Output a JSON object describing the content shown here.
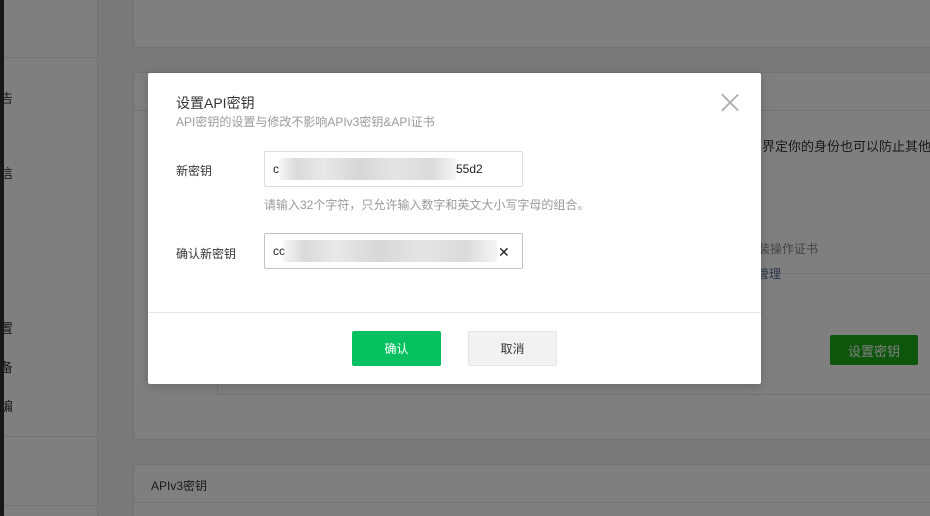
{
  "background": {
    "left_fragments": [
      "告",
      "信",
      "置",
      "备",
      "编"
    ],
    "intro_text": "界定你的身份也可以防止其他人",
    "cert_status": "你已安装操作证书",
    "cert_manage_link": "证书管理",
    "set_key_button": "设置密钥",
    "section_title": "APIv3密钥"
  },
  "dialog": {
    "title": "设置API密钥",
    "subtitle": "API密钥的设置与修改不影响APIv3密钥&API证书",
    "new_key": {
      "label": "新密钥",
      "value_prefix": "c",
      "value_suffix": "55d2"
    },
    "hint": "请输入32个字符，只允许输入数字和英文大小写字母的组合。",
    "confirm_key": {
      "label": "确认新密钥",
      "value_prefix": "cc"
    },
    "confirm_button": "确认",
    "cancel_button": "取消"
  },
  "colors": {
    "primary_green": "#07c160",
    "link_blue": "#576b95",
    "mask": "rgba(0,0,0,0.5)"
  },
  "icons": {
    "close": "close-icon",
    "clear": "clear-input-icon",
    "check": "check-circle-icon"
  }
}
